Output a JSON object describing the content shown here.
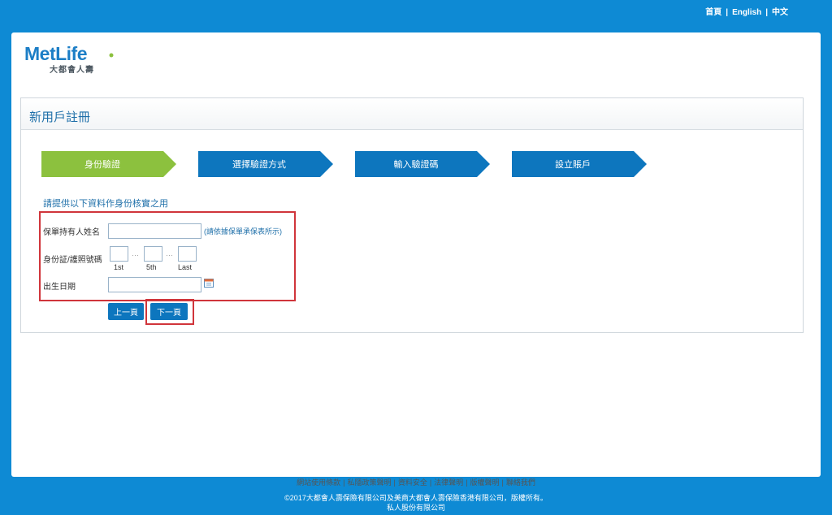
{
  "top_nav": {
    "home": "首頁",
    "english": "English",
    "chinese": "中文",
    "separator": "|"
  },
  "logo": {
    "brand": "MetLife",
    "subtitle": "大都會人壽"
  },
  "card": {
    "title": "新用戶註冊"
  },
  "steps": [
    {
      "label": "身份驗證",
      "active": true
    },
    {
      "label": "選擇驗證方式",
      "active": false
    },
    {
      "label": "輸入驗證碼",
      "active": false
    },
    {
      "label": "設立賬戶",
      "active": false
    }
  ],
  "instruction": "請提供以下資料作身份核實之用",
  "form": {
    "holder_name_label": "保單持有人姓名",
    "holder_name_value": "",
    "holder_name_hint": "(請依據保單承保表所示)",
    "id_label": "身份証/護照號碼",
    "id_boxes": [
      {
        "value": "",
        "caption": "1st"
      },
      {
        "value": "",
        "caption": "5th"
      },
      {
        "value": "",
        "caption": "Last"
      }
    ],
    "id_dots": "···",
    "dob_label": "出生日期",
    "dob_value": ""
  },
  "buttons": {
    "prev": "上一頁",
    "next": "下一頁"
  },
  "footer": {
    "links": [
      "網站使用條款",
      "私隱政策聲明",
      "資料安全",
      "法律聲明",
      "版權聲明",
      "聯絡我們"
    ],
    "separator": "|",
    "copyright_line1": "©2017大都會人壽保險有限公司及美商大都會人壽保險香港有限公司，版權所有。",
    "copyright_line2": "私人股份有限公司"
  },
  "colors": {
    "header_blue": "#0e8ad4",
    "step_active": "#8cc13e",
    "step_inactive": "#0d76be",
    "highlight_red": "#d0353b"
  }
}
